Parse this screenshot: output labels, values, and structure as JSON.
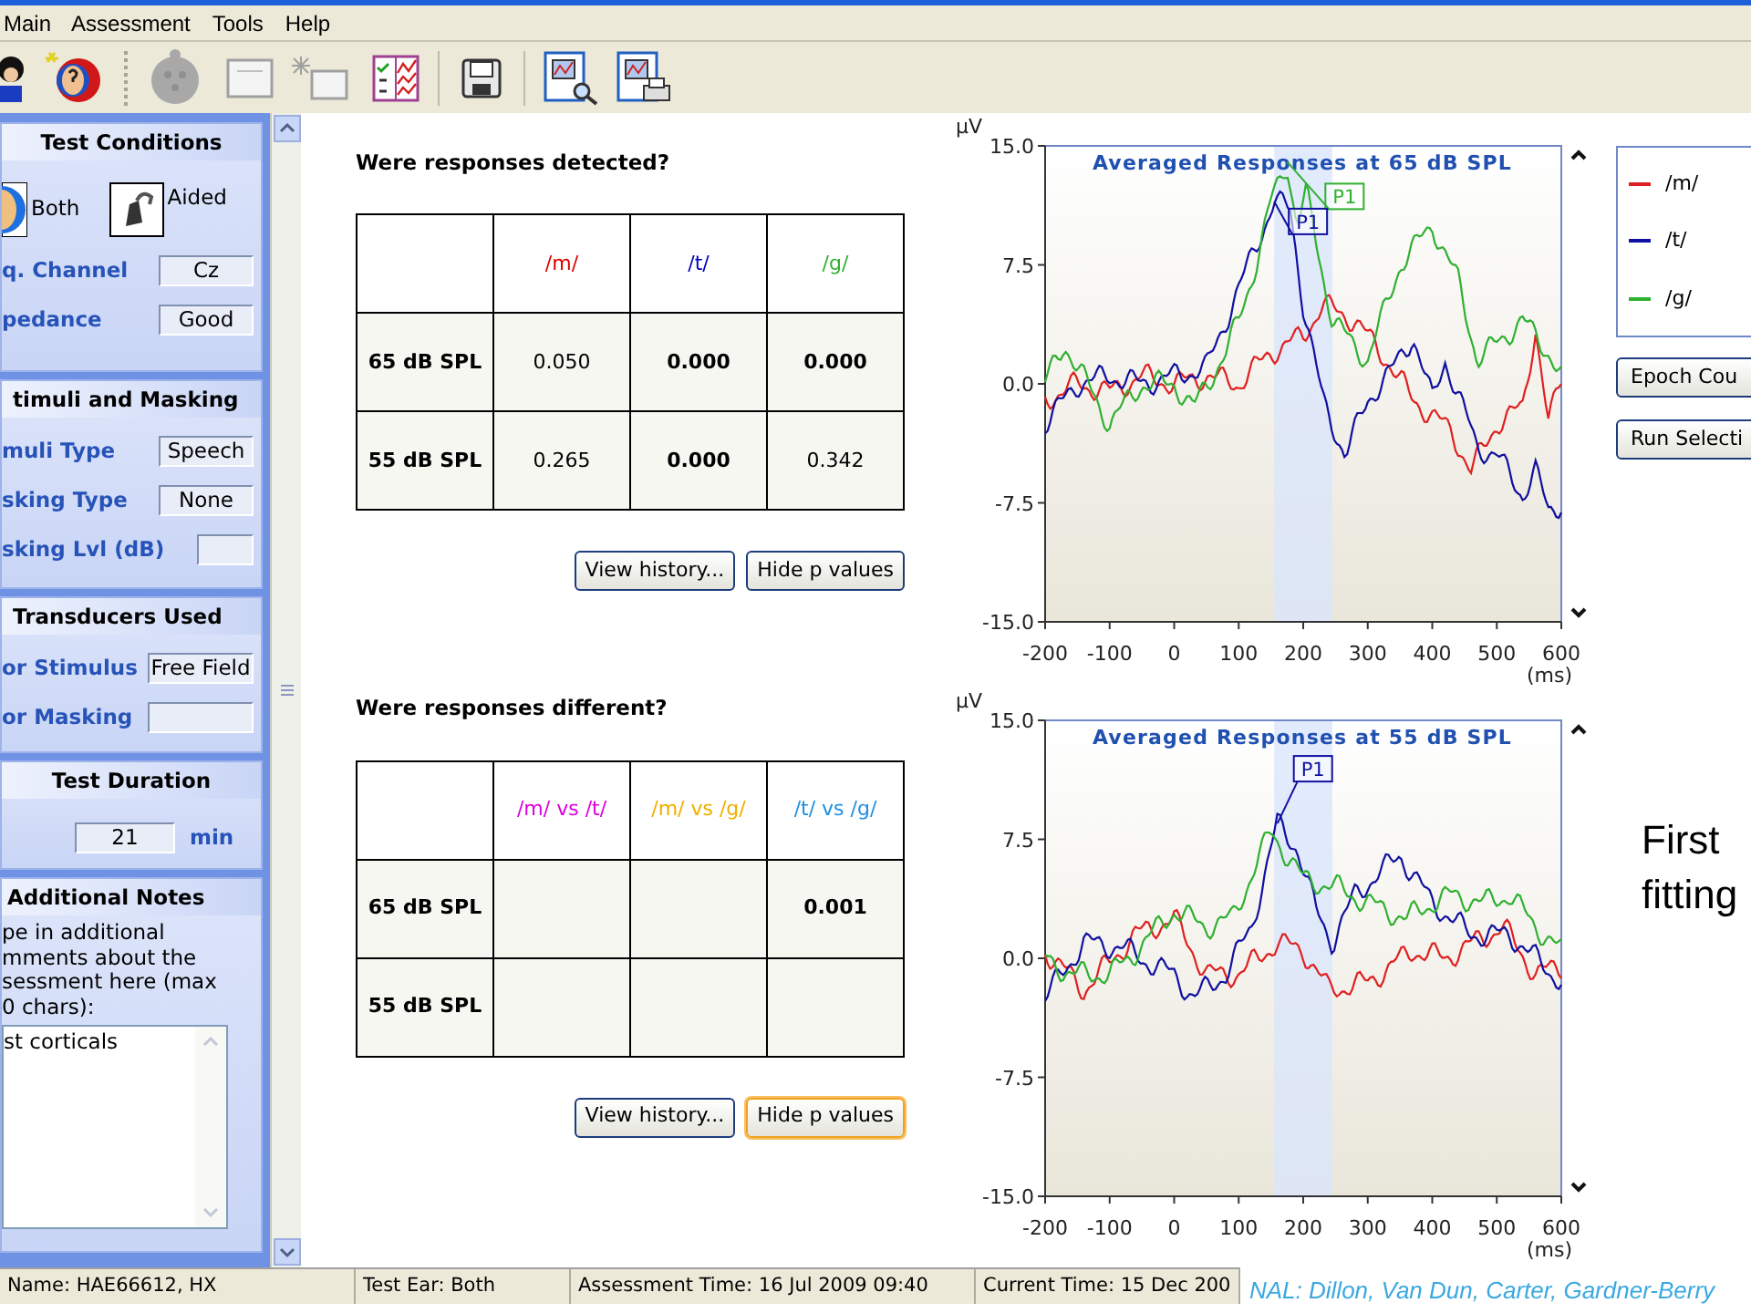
{
  "menu": [
    "Main",
    "Assessment",
    "Tools",
    "Help"
  ],
  "sidebar": [
    {
      "title": "Test Conditions",
      "options": [
        {
          "label": "Both",
          "kind": "ear"
        },
        {
          "label": "Aided",
          "kind": "aid"
        }
      ],
      "fields": [
        {
          "label": "q. Channel",
          "value": "Cz"
        },
        {
          "label": "pedance",
          "value": "Good"
        }
      ]
    },
    {
      "title": "timuli and Masking",
      "fields": [
        {
          "label": "muli Type",
          "value": "Speech"
        },
        {
          "label": "sking Type",
          "value": "None"
        },
        {
          "label": "sking Lvl (dB)"
        }
      ]
    },
    {
      "title": "Transducers Used",
      "fields": [
        {
          "label": "or Stimulus",
          "value": "Free Field"
        },
        {
          "label": "or Masking"
        }
      ]
    },
    {
      "title": "Test Duration",
      "duration": {
        "value": "21",
        "unit": "min"
      }
    },
    {
      "title": "Additional Notes",
      "prompt_lines": [
        "pe in additional",
        "mments about the",
        "sessment here (max",
        "0 chars):"
      ],
      "notes": "st corticals"
    }
  ],
  "tables": [
    {
      "title": "Were responses detected?",
      "columns": [
        {
          "label": "/m/",
          "color": "#e00000"
        },
        {
          "label": "/t/",
          "color": "#0000c0"
        },
        {
          "label": "/g/",
          "color": "#30b030"
        }
      ],
      "rows": [
        {
          "label": "65 dB SPL",
          "cells": [
            {
              "text": "0.050",
              "bold": false
            },
            {
              "text": "0.000",
              "bold": true
            },
            {
              "text": "0.000",
              "bold": true
            }
          ]
        },
        {
          "label": "55 dB SPL",
          "cells": [
            {
              "text": "0.265",
              "bold": false
            },
            {
              "text": "0.000",
              "bold": true
            },
            {
              "text": "0.342",
              "bold": false
            }
          ]
        }
      ],
      "buttons": [
        {
          "label": "View history...",
          "focused": false
        },
        {
          "label": "Hide p values",
          "focused": false
        }
      ]
    },
    {
      "title": "Were responses different?",
      "columns": [
        {
          "label": "/m/ vs /t/",
          "color": "#e000e0"
        },
        {
          "label": "/m/ vs /g/",
          "color": "#f0b000"
        },
        {
          "label": "/t/ vs /g/",
          "color": "#2090e0"
        }
      ],
      "rows": [
        {
          "label": "65 dB SPL",
          "cells": [
            null,
            null,
            {
              "text": "0.001",
              "bold": true
            }
          ]
        },
        {
          "label": "55 dB SPL",
          "cells": [
            null,
            null,
            null
          ]
        }
      ],
      "buttons": [
        {
          "label": "View history...",
          "focused": false
        },
        {
          "label": "Hide p values",
          "focused": true
        }
      ]
    }
  ],
  "charts": [
    {
      "title": "Averaged Responses at 65 dB SPL",
      "y_unit": "µV",
      "y_ticks": [
        "15.0",
        "7.5",
        "0.0",
        "-7.5",
        "-15.0"
      ],
      "x_ticks": [
        "-200",
        "-100",
        "0",
        "100",
        "200",
        "300",
        "400",
        "500",
        "600"
      ],
      "x_unit": "(ms)",
      "markers": [
        {
          "label": "P1",
          "color": "#30b030"
        },
        {
          "label": "P1",
          "color": "#1010a0"
        }
      ]
    },
    {
      "title": "Averaged Responses at 55 dB SPL",
      "y_unit": "µV",
      "y_ticks": [
        "15.0",
        "7.5",
        "0.0",
        "-7.5",
        "-15.0"
      ],
      "x_ticks": [
        "-200",
        "-100",
        "0",
        "100",
        "200",
        "300",
        "400",
        "500",
        "600"
      ],
      "x_unit": "(ms)",
      "markers": [
        {
          "label": "P1",
          "color": "#1010a0"
        }
      ]
    }
  ],
  "legend": [
    {
      "label": "/m/",
      "color": "#e02020"
    },
    {
      "label": "/t/",
      "color": "#1010a0"
    },
    {
      "label": "/g/",
      "color": "#30b030"
    }
  ],
  "side_buttons": [
    "Epoch Cou",
    "Run Selecti"
  ],
  "slide_caption": "First fitting",
  "status_bar": [
    "Name: HAE66612, HX",
    "Test Ear: Both",
    "Assessment Time: 16 Jul 2009 09:40",
    "Current Time: 15 Dec 200"
  ],
  "credit": "NAL: Dillon, Van Dun, Carter, Gardner-Berry"
}
